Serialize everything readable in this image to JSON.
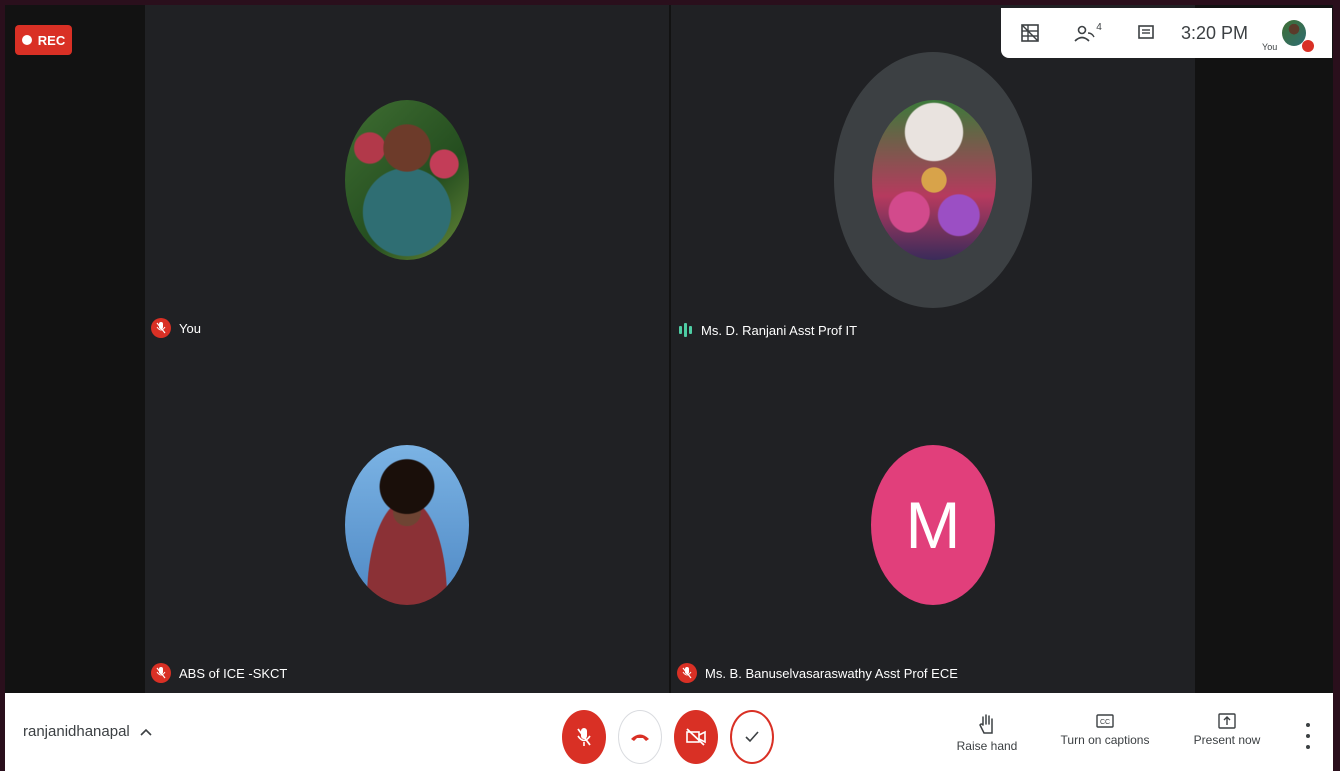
{
  "recording": {
    "label": "REC"
  },
  "topbar": {
    "time": "3:20 PM",
    "participants_count": "4",
    "you_label": "You"
  },
  "tiles": [
    {
      "name": "You",
      "muted": true
    },
    {
      "name": "Ms. D. Ranjani Asst Prof IT",
      "muted": false,
      "speaking": true
    },
    {
      "name": "ABS of ICE -SKCT",
      "muted": true
    },
    {
      "name": "Ms. B. Banuselvasaraswathy Asst Prof ECE",
      "muted": true,
      "initial": "M"
    }
  ],
  "bottombar": {
    "meeting_name": "ranjanidhanapal",
    "actions": {
      "raise_hand": "Raise hand",
      "captions": "Turn on captions",
      "present": "Present now"
    }
  },
  "colors": {
    "accent_red": "#d93025",
    "initial_avatar": "#e13f7b",
    "speaking": "#4ecca3"
  },
  "icons": [
    "grid-layout-icon",
    "people-icon",
    "chat-icon",
    "mic-off-icon",
    "end-call-icon",
    "camera-off-icon",
    "check-icon",
    "raise-hand-icon",
    "captions-icon",
    "present-icon",
    "more-vert-icon",
    "chevron-up-icon"
  ]
}
